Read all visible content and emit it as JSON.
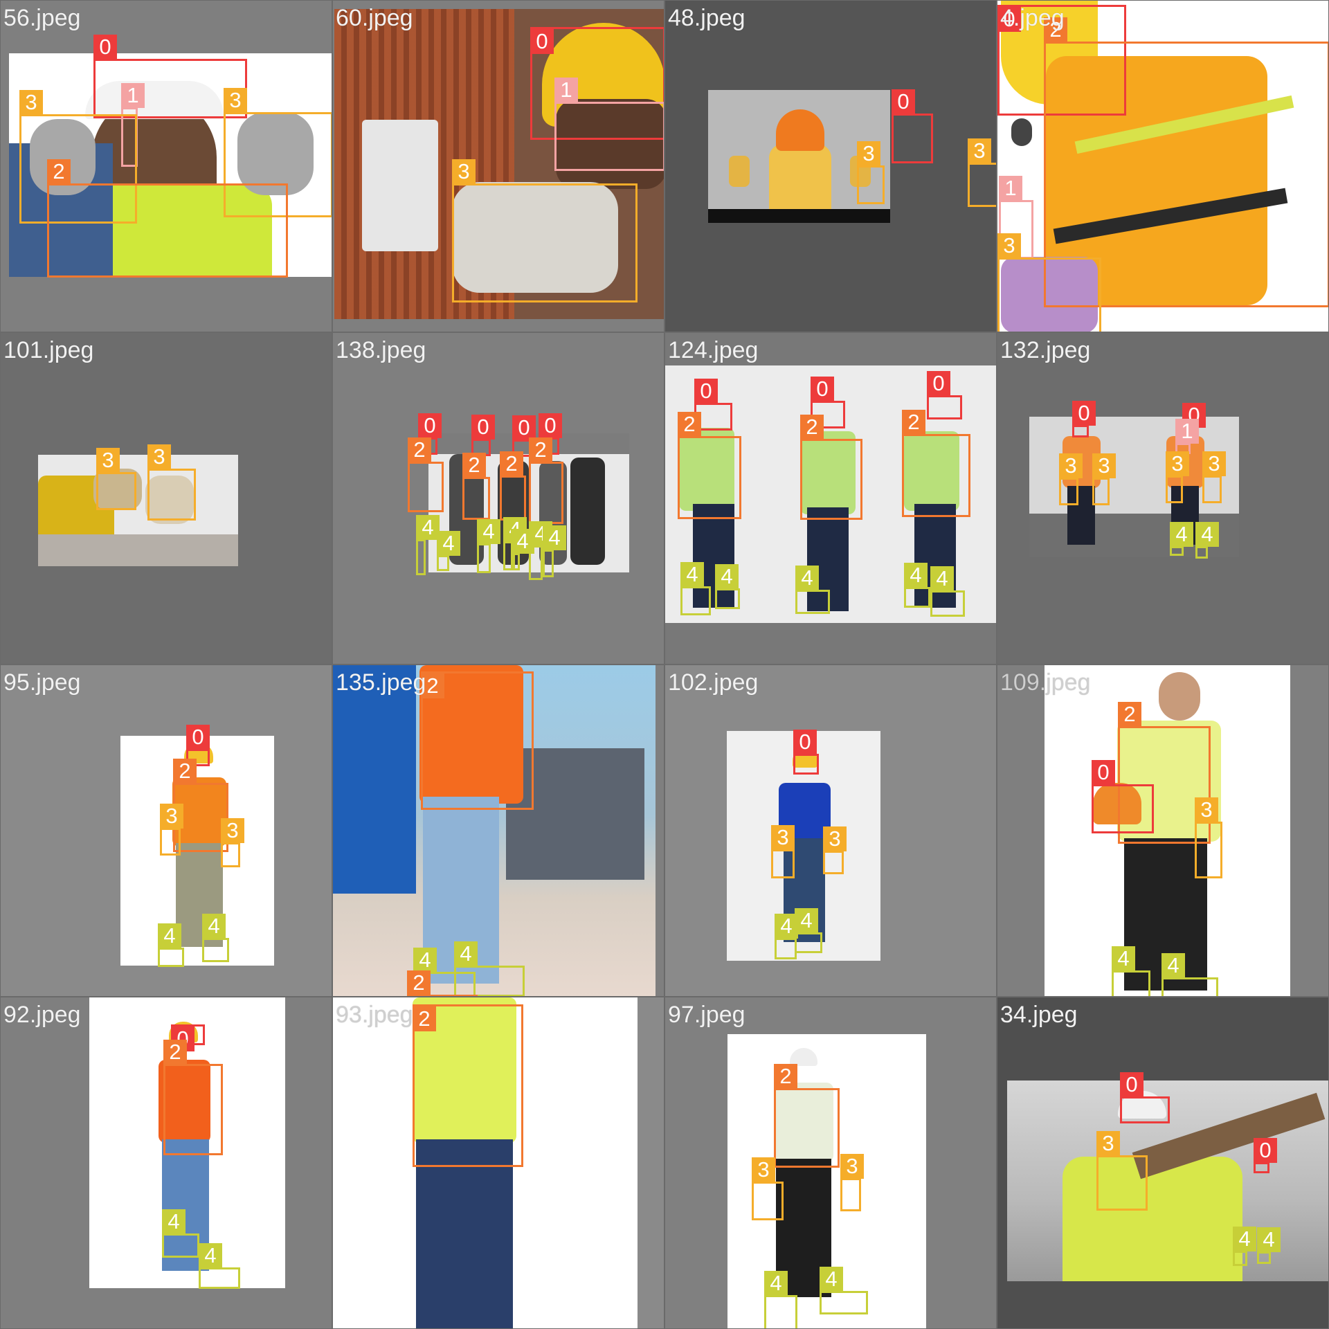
{
  "colors": {
    "0": "#ed3b3b",
    "1": "#f4a3a3",
    "2": "#f2782f",
    "3": "#f5ad2a",
    "4": "#c7cf38"
  },
  "tiles": [
    {
      "name": "56.jpeg",
      "boxes": [
        {
          "cls": "0"
        },
        {
          "cls": "1"
        },
        {
          "cls": "3"
        },
        {
          "cls": "3"
        },
        {
          "cls": "2"
        }
      ]
    },
    {
      "name": "60.jpeg",
      "boxes": [
        {
          "cls": "0"
        },
        {
          "cls": "1"
        },
        {
          "cls": "3"
        }
      ]
    },
    {
      "name": "48.jpeg",
      "boxes": [
        {
          "cls": "0"
        },
        {
          "cls": "3"
        },
        {
          "cls": "3"
        }
      ]
    },
    {
      "name": "4.jpeg",
      "boxes": [
        {
          "cls": "0"
        },
        {
          "cls": "2"
        },
        {
          "cls": "1"
        },
        {
          "cls": "3"
        }
      ]
    },
    {
      "name": "101.jpeg",
      "boxes": [
        {
          "cls": "3"
        },
        {
          "cls": "3"
        }
      ]
    },
    {
      "name": "138.jpeg",
      "boxes": [
        {
          "cls": "0"
        },
        {
          "cls": "0"
        },
        {
          "cls": "0"
        },
        {
          "cls": "0"
        },
        {
          "cls": "2"
        },
        {
          "cls": "2"
        },
        {
          "cls": "2"
        },
        {
          "cls": "2"
        },
        {
          "cls": "4"
        },
        {
          "cls": "4"
        },
        {
          "cls": "4"
        },
        {
          "cls": "4"
        },
        {
          "cls": "4"
        },
        {
          "cls": "4"
        },
        {
          "cls": "4"
        }
      ]
    },
    {
      "name": "124.jpeg",
      "boxes": [
        {
          "cls": "0"
        },
        {
          "cls": "0"
        },
        {
          "cls": "0"
        },
        {
          "cls": "2"
        },
        {
          "cls": "2"
        },
        {
          "cls": "2"
        },
        {
          "cls": "4"
        },
        {
          "cls": "4"
        },
        {
          "cls": "4"
        },
        {
          "cls": "4"
        },
        {
          "cls": "4"
        }
      ]
    },
    {
      "name": "132.jpeg",
      "boxes": [
        {
          "cls": "0"
        },
        {
          "cls": "0"
        },
        {
          "cls": "1"
        },
        {
          "cls": "3"
        },
        {
          "cls": "3"
        },
        {
          "cls": "3"
        },
        {
          "cls": "3"
        },
        {
          "cls": "4"
        },
        {
          "cls": "4"
        }
      ]
    },
    {
      "name": "95.jpeg",
      "boxes": [
        {
          "cls": "0"
        },
        {
          "cls": "2"
        },
        {
          "cls": "3"
        },
        {
          "cls": "3"
        },
        {
          "cls": "4"
        },
        {
          "cls": "4"
        }
      ]
    },
    {
      "name": "135.jpeg",
      "boxes": [
        {
          "cls": "2"
        },
        {
          "cls": "4"
        },
        {
          "cls": "4"
        },
        {
          "cls": "2"
        }
      ]
    },
    {
      "name": "102.jpeg",
      "boxes": [
        {
          "cls": "0"
        },
        {
          "cls": "3"
        },
        {
          "cls": "3"
        },
        {
          "cls": "4"
        },
        {
          "cls": "4"
        }
      ]
    },
    {
      "name": "109.jpeg",
      "boxes": [
        {
          "cls": "2"
        },
        {
          "cls": "0"
        },
        {
          "cls": "3"
        },
        {
          "cls": "4"
        },
        {
          "cls": "4"
        }
      ]
    },
    {
      "name": "92.jpeg",
      "boxes": [
        {
          "cls": "0"
        },
        {
          "cls": "2"
        },
        {
          "cls": "4"
        },
        {
          "cls": "4"
        }
      ]
    },
    {
      "name": "93.jpeg",
      "boxes": [
        {
          "cls": "2"
        }
      ]
    },
    {
      "name": "97.jpeg",
      "boxes": [
        {
          "cls": "2"
        },
        {
          "cls": "3"
        },
        {
          "cls": "3"
        },
        {
          "cls": "4"
        },
        {
          "cls": "4"
        }
      ]
    },
    {
      "name": "34.jpeg",
      "boxes": [
        {
          "cls": "0"
        },
        {
          "cls": "0"
        },
        {
          "cls": "3"
        },
        {
          "cls": "4"
        },
        {
          "cls": "4"
        }
      ]
    }
  ]
}
